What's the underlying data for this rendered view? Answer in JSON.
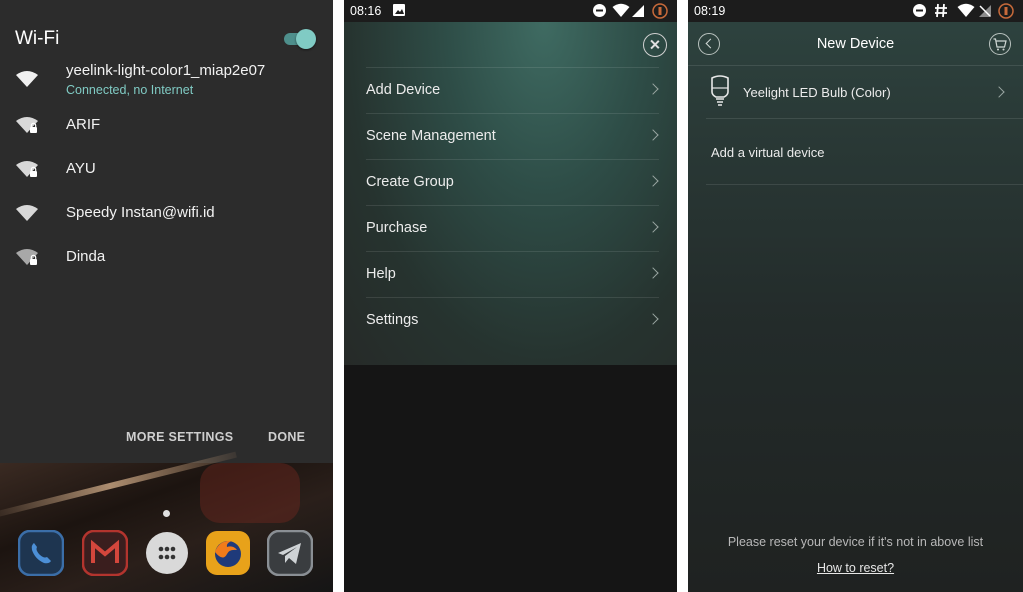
{
  "wifi_panel": {
    "title": "Wi-Fi",
    "toggle_on": true,
    "networks": [
      {
        "ssid": "yeelink-light-color1_miap2e07",
        "status": "Connected, no Internet",
        "secured": false
      },
      {
        "ssid": "ARIF",
        "status": "",
        "secured": true
      },
      {
        "ssid": "AYU",
        "status": "",
        "secured": true
      },
      {
        "ssid": "Speedy Instan@wifi.id",
        "status": "",
        "secured": false
      },
      {
        "ssid": "Dinda",
        "status": "",
        "secured": true
      }
    ],
    "more_settings_label": "MORE SETTINGS",
    "done_label": "DONE",
    "dock_icons": [
      "phone-icon",
      "gmail-icon",
      "app-drawer-icon",
      "firefox-icon",
      "telegram-icon"
    ]
  },
  "menu_panel": {
    "status_time": "08:16",
    "items": [
      {
        "label": "Add Device"
      },
      {
        "label": "Scene Management"
      },
      {
        "label": "Create Group"
      },
      {
        "label": "Purchase"
      },
      {
        "label": "Help"
      },
      {
        "label": "Settings"
      }
    ]
  },
  "new_device_panel": {
    "status_time": "08:19",
    "title": "New Device",
    "device_label": "Yeelight LED Bulb (Color)",
    "virtual_label": "Add a virtual device",
    "reset_text": "Please reset your device if it's not in above list",
    "how_to_reset_label": "How to reset?"
  },
  "colors": {
    "accent": "#80cbc4",
    "wifi_bg": "#2c2c2c",
    "menu_teal": "#3f6b62"
  }
}
